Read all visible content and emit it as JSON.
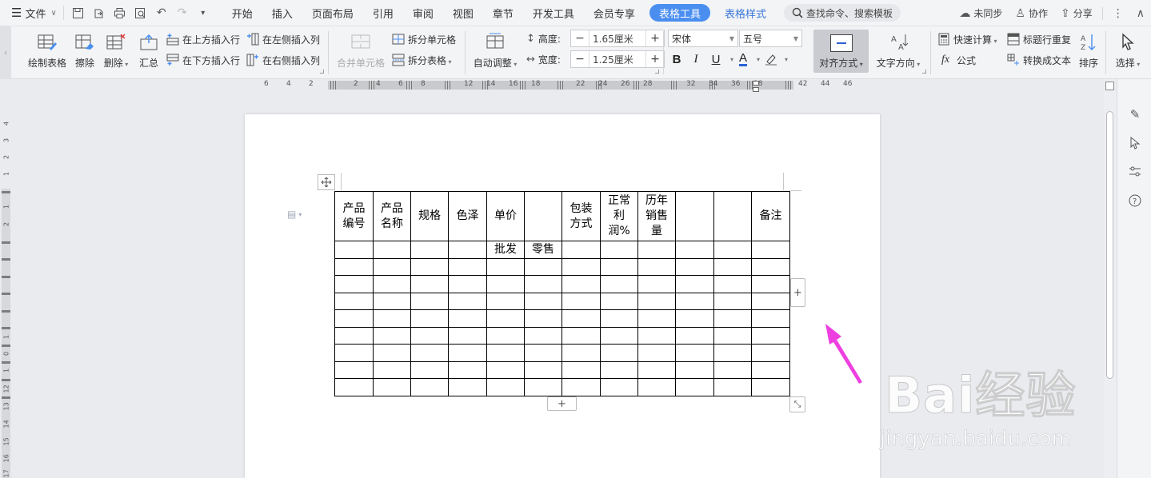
{
  "menubar": {
    "file_label": "文件",
    "tabs": [
      "开始",
      "插入",
      "页面布局",
      "引用",
      "审阅",
      "视图",
      "章节",
      "开发工具",
      "会员专享",
      "表格工具",
      "表格样式"
    ],
    "search_placeholder": "查找命令、搜索模板",
    "sync_label": "未同步",
    "collab_label": "协作",
    "share_label": "分享"
  },
  "ribbon": {
    "draw_table": "绘制表格",
    "erase": "擦除",
    "delete": "删除",
    "summary": "汇总",
    "insert_above": "在上方插入行",
    "insert_below": "在下方插入行",
    "insert_left": "在左侧插入列",
    "insert_right": "在右侧插入列",
    "merge_cells": "合并单元格",
    "split_cells": "拆分单元格",
    "split_table": "拆分表格",
    "auto_fit": "自动调整",
    "height_label": "高度:",
    "height_value": "1.65厘米",
    "width_label": "宽度:",
    "width_value": "1.25厘米",
    "font_name": "宋体",
    "font_size": "五号",
    "align": "对齐方式",
    "text_direction": "文字方向",
    "quick_calc": "快速计算",
    "formula": "公式",
    "repeat_header": "标题行重复",
    "convert_text": "转换成文本",
    "sort": "排序",
    "select": "选择"
  },
  "ruler": {
    "h_numbers": [
      "6",
      "4",
      "2",
      "2",
      "4",
      "6",
      "8",
      "12",
      "14",
      "16",
      "18",
      "22",
      "24",
      "26",
      "28",
      "32",
      "34",
      "36",
      "38",
      "42",
      "44",
      "46"
    ],
    "v_numbers": [
      "4",
      "3",
      "2",
      "1",
      "1",
      "2",
      "1",
      "0",
      "1",
      "12",
      "13",
      "14",
      "15",
      "16",
      "17"
    ]
  },
  "table": {
    "header_row": [
      "产品编号",
      "产品名称",
      "规格",
      "色泽",
      "单价",
      "",
      "包装方式",
      "正常利润%",
      "历年销售量",
      "",
      "",
      "备注"
    ],
    "header_wrapped": [
      [
        "产品",
        "编号"
      ],
      [
        "产品",
        "名称"
      ],
      [
        "规格"
      ],
      [
        "色泽"
      ],
      [
        "单价"
      ],
      [
        ""
      ],
      [
        "包装",
        "方式"
      ],
      [
        "正常",
        "利",
        "润%"
      ],
      [
        "历年",
        "销售",
        "量"
      ],
      [
        ""
      ],
      [
        ""
      ],
      [
        "备注"
      ]
    ],
    "sub_row": [
      "",
      "",
      "",
      "",
      "批发",
      "零售",
      "",
      "",
      "",
      "",
      "",
      ""
    ],
    "empty_rows": 9
  },
  "colors": {
    "accent": "#4a8ef0",
    "arrow": "#ee3fe1"
  },
  "watermark": {
    "logo": "Bai经验",
    "url": "jingyan.baidu.com"
  }
}
